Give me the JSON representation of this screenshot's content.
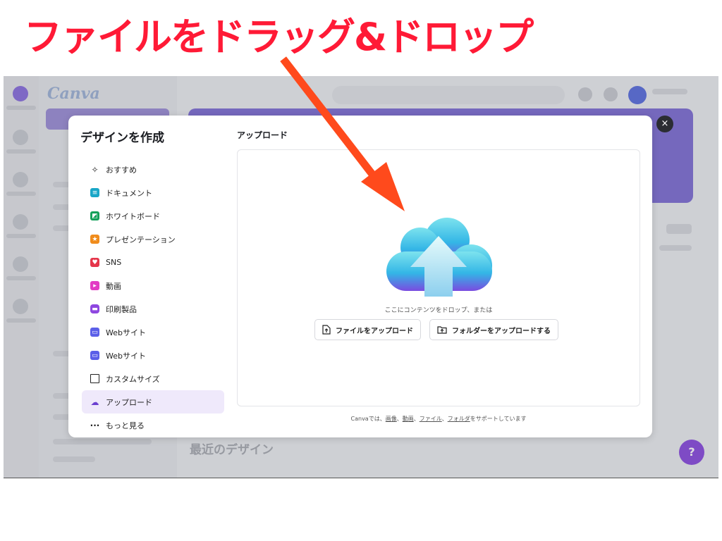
{
  "caption": "ファイルをドラッグ&ドロップ",
  "background": {
    "logo": "Canva",
    "recent_title": "最近のデザイン",
    "help_label": "?"
  },
  "modal": {
    "title": "デザインを作成",
    "close_label": "×",
    "nav": [
      {
        "label": "おすすめ",
        "icon": "sparkle-icon",
        "color": "#222222"
      },
      {
        "label": "ドキュメント",
        "icon": "document-icon",
        "color": "#19a6c7"
      },
      {
        "label": "ホワイトボード",
        "icon": "whiteboard-icon",
        "color": "#15a05a"
      },
      {
        "label": "プレゼンテーション",
        "icon": "presentation-icon",
        "color": "#f08c1c"
      },
      {
        "label": "SNS",
        "icon": "heart-icon",
        "color": "#e5364b"
      },
      {
        "label": "動画",
        "icon": "video-icon",
        "color": "#e23bc4"
      },
      {
        "label": "印刷製品",
        "icon": "printer-icon",
        "color": "#8e47e0"
      },
      {
        "label": "Webサイト",
        "icon": "website-icon",
        "color": "#5b5fe8"
      },
      {
        "label": "Webサイト",
        "icon": "website-icon",
        "color": "#5b5fe8"
      },
      {
        "label": "カスタムサイズ",
        "icon": "custom-size-icon",
        "color": "#222222"
      },
      {
        "label": "アップロード",
        "icon": "upload-cloud-icon",
        "color": "#6a3fd0",
        "active": true
      },
      {
        "label": "もっと見る",
        "icon": "more-icon",
        "color": "#222222"
      }
    ],
    "upload": {
      "heading": "アップロード",
      "drop_text": "ここにコンテンツをドロップ、または",
      "upload_file_button": "ファイルをアップロード",
      "upload_folder_button": "フォルダーをアップロードする",
      "support_prefix": "Canvaでは、",
      "support_links": [
        "画像",
        "動画",
        "ファイル",
        "フォルダ"
      ],
      "support_sep": "、",
      "support_suffix": "をサポートしています"
    }
  },
  "colors": {
    "caption": "#ff1a36",
    "arrow": "#ff4a1c",
    "accent": "#8a4ce0"
  }
}
